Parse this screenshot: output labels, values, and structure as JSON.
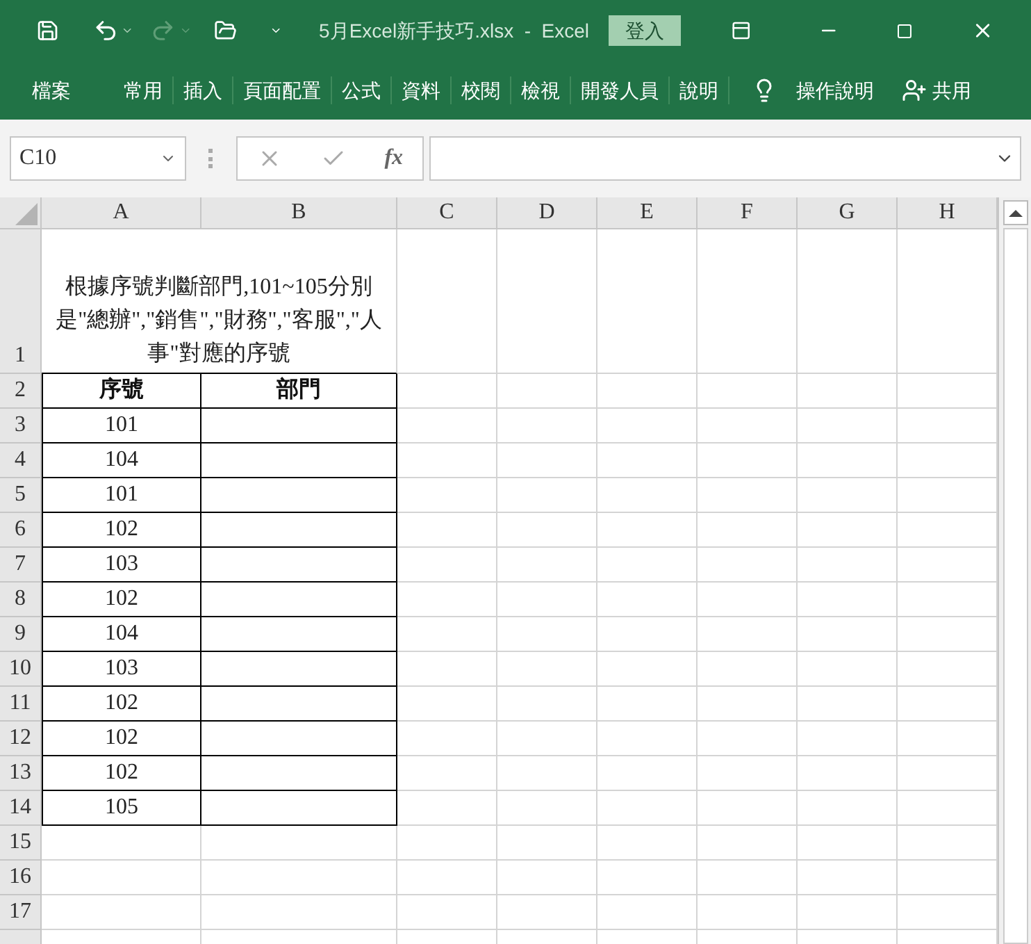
{
  "title_bar": {
    "title": "5月Excel新手技巧.xlsx  -  Excel",
    "sign_in": "登入"
  },
  "ribbon": {
    "tabs": [
      "檔案",
      "常用",
      "插入",
      "頁面配置",
      "公式",
      "資料",
      "校閱",
      "檢視",
      "開發人員",
      "說明"
    ],
    "tell_me": "操作說明",
    "share": "共用"
  },
  "formula_bar": {
    "name_box": "C10",
    "function_label": "fx"
  },
  "sheet": {
    "columns": [
      "A",
      "B",
      "C",
      "D",
      "E",
      "F",
      "G",
      "H"
    ],
    "title_row": {
      "number": "1",
      "text": "根據序號判斷部門,101~105分別是\"總辦\",\"銷售\",\"財務\",\"客服\",\"人事\"對應的序號"
    },
    "header_row": {
      "number": "2",
      "cells": [
        "序號",
        "部門"
      ]
    },
    "data_rows": [
      {
        "number": "3",
        "id": "101"
      },
      {
        "number": "4",
        "id": "104"
      },
      {
        "number": "5",
        "id": "101"
      },
      {
        "number": "6",
        "id": "102"
      },
      {
        "number": "7",
        "id": "103"
      },
      {
        "number": "8",
        "id": "102"
      },
      {
        "number": "9",
        "id": "104"
      },
      {
        "number": "10",
        "id": "103"
      },
      {
        "number": "11",
        "id": "102"
      },
      {
        "number": "12",
        "id": "102"
      },
      {
        "number": "13",
        "id": "102"
      },
      {
        "number": "14",
        "id": "105"
      }
    ],
    "empty_rows": [
      "15",
      "16",
      "17"
    ]
  }
}
